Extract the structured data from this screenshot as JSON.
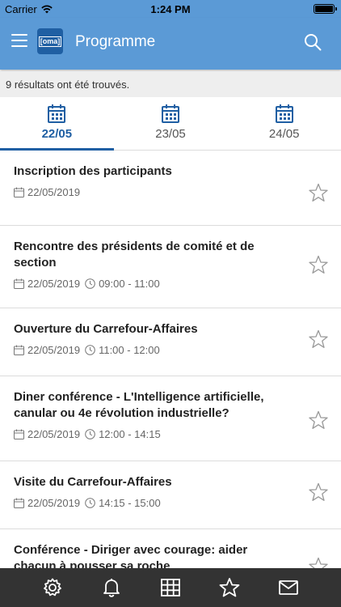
{
  "status_bar": {
    "carrier": "Carrier",
    "time": "1:24 PM"
  },
  "header": {
    "title": "Programme",
    "logo_text": "[oma]"
  },
  "results_text": "9 résultats ont été trouvés.",
  "date_tabs": [
    {
      "label": "22/05",
      "active": true
    },
    {
      "label": "23/05",
      "active": false
    },
    {
      "label": "24/05",
      "active": false
    }
  ],
  "sessions": [
    {
      "title": "Inscription des participants",
      "date": "22/05/2019",
      "time": ""
    },
    {
      "title": "Rencontre des présidents de comité et de section",
      "date": "22/05/2019",
      "time": "09:00 - 11:00"
    },
    {
      "title": "Ouverture du Carrefour-Affaires",
      "date": "22/05/2019",
      "time": "11:00 - 12:00"
    },
    {
      "title": "Diner conférence - L'Intelligence artificielle, canular ou 4e révolution industrielle?",
      "date": "22/05/2019",
      "time": "12:00 - 14:15"
    },
    {
      "title": "Visite du Carrefour-Affaires",
      "date": "22/05/2019",
      "time": "14:15 - 15:00"
    },
    {
      "title": "Conférence - Diriger avec courage: aider chacun à pousser sa roche",
      "date": "",
      "time": ""
    }
  ],
  "bottom_tabs": [
    "settings-icon",
    "bell-icon",
    "grid-icon",
    "star-icon",
    "mail-icon"
  ],
  "colors": {
    "header": "#5b9ad6",
    "accent": "#1f5fa3",
    "tabbar": "#333333"
  }
}
